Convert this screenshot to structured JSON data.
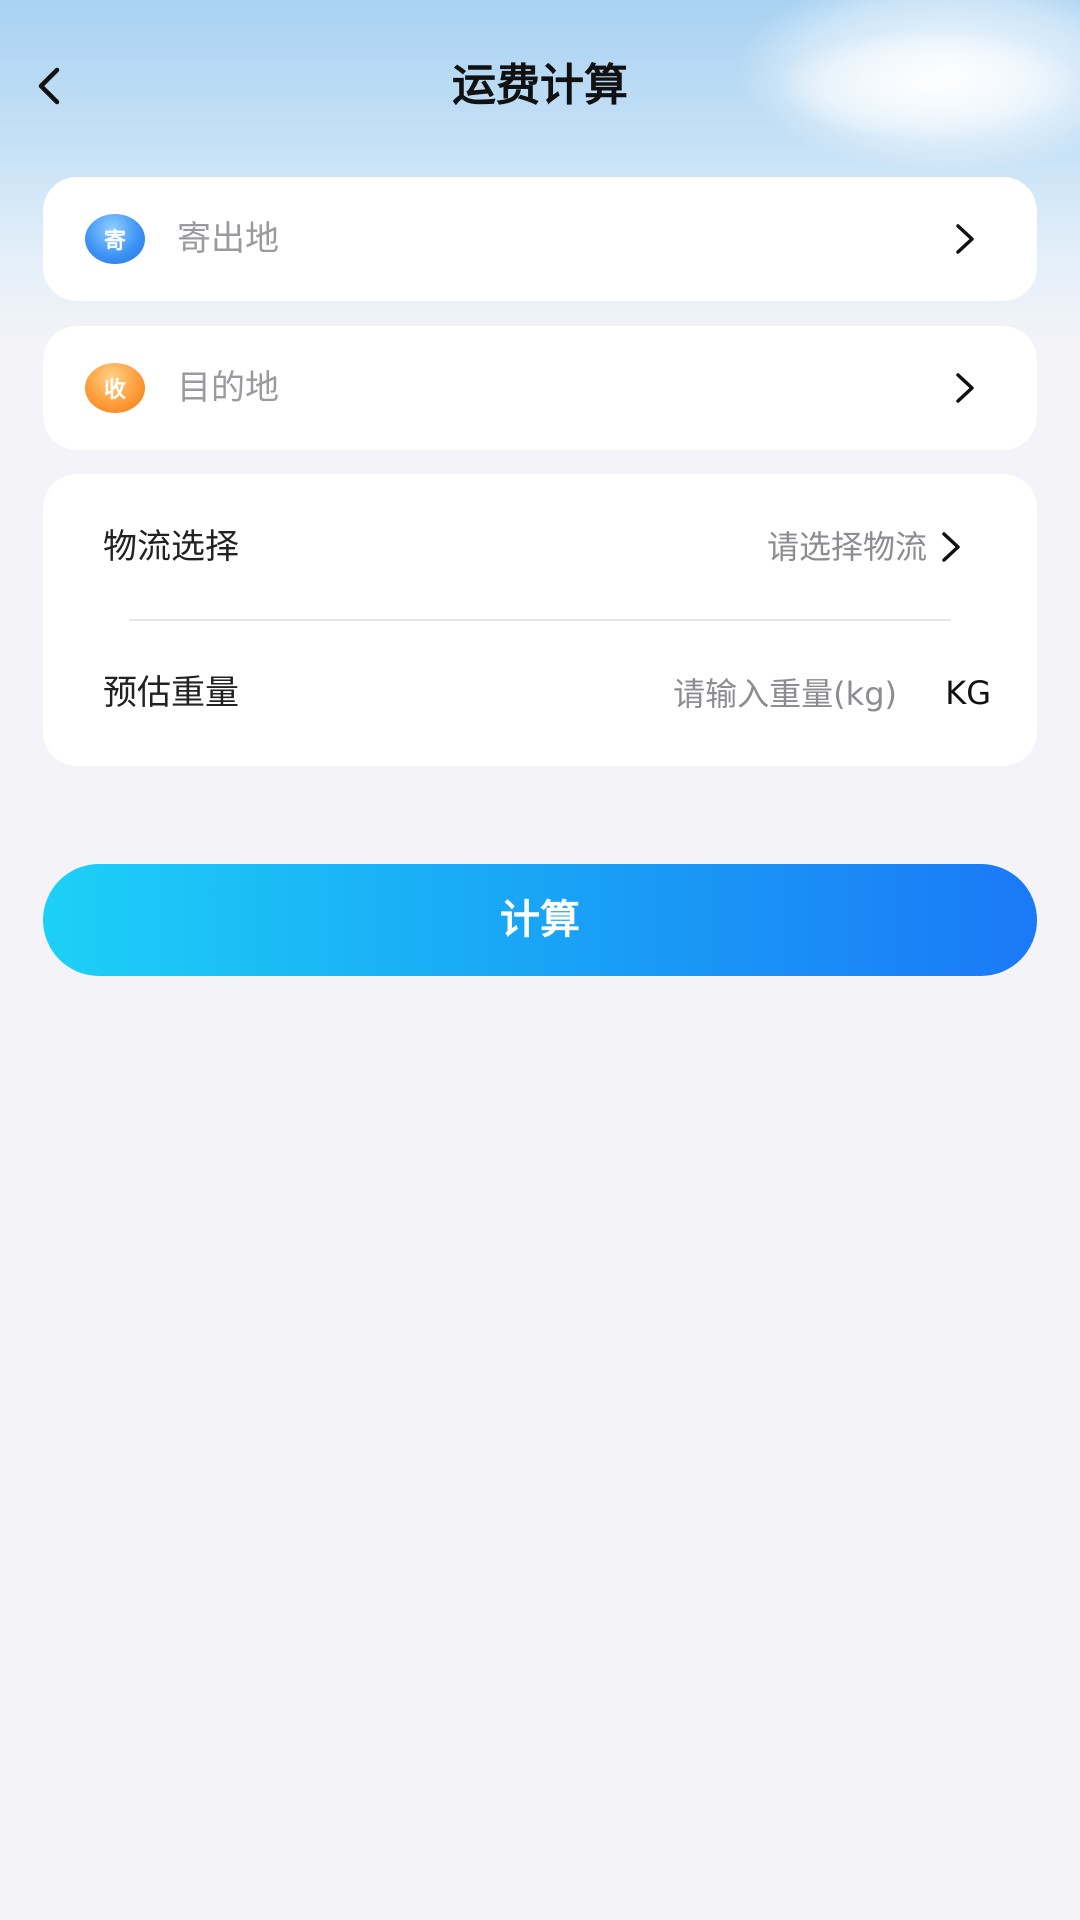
{
  "header": {
    "title": "运费计算"
  },
  "origin": {
    "badge": "寄",
    "placeholder": "寄出地"
  },
  "destination": {
    "badge": "收",
    "placeholder": "目的地"
  },
  "logistics": {
    "label": "物流选择",
    "placeholder": "请选择物流"
  },
  "weight": {
    "label": "预估重量",
    "placeholder": "请输入重量(kg)",
    "unit": "KG"
  },
  "calculate_button": {
    "label": "计算"
  },
  "colors": {
    "origin_badge": "#3f95f5",
    "destination_badge": "#ff9d3a",
    "button_start": "#1dd0f7",
    "button_end": "#1a79f7",
    "page_background": "#f3f3f8"
  },
  "icons": {
    "back": "chevron-left-icon",
    "row_arrow": "chevron-right-icon"
  }
}
